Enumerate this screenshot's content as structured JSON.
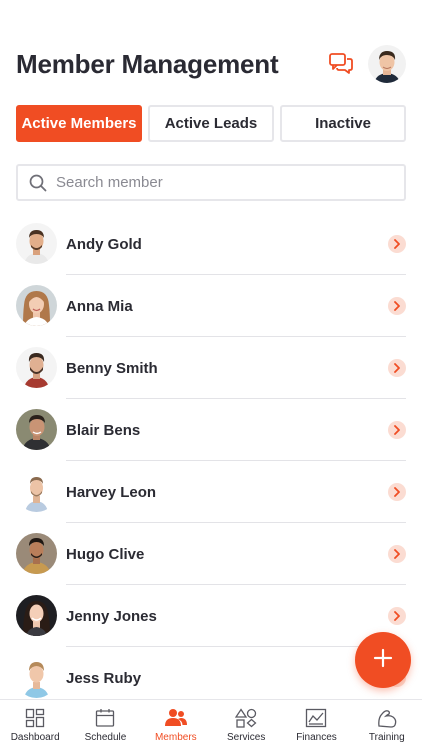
{
  "header": {
    "title": "Member Management"
  },
  "tabs": [
    {
      "label": "Active Members",
      "active": true
    },
    {
      "label": "Active Leads",
      "active": false
    },
    {
      "label": "Inactive",
      "active": false
    }
  ],
  "search": {
    "placeholder": "Search member",
    "value": ""
  },
  "members": [
    {
      "name": "Andy Gold"
    },
    {
      "name": "Anna Mia"
    },
    {
      "name": "Benny Smith"
    },
    {
      "name": "Blair Bens"
    },
    {
      "name": "Harvey Leon"
    },
    {
      "name": "Hugo Clive"
    },
    {
      "name": "Jenny Jones"
    },
    {
      "name": "Jess Ruby"
    }
  ],
  "nav": [
    {
      "label": "Dashboard",
      "icon": "dashboard-icon"
    },
    {
      "label": "Schedule",
      "icon": "calendar-icon"
    },
    {
      "label": "Members",
      "icon": "members-icon",
      "active": true
    },
    {
      "label": "Services",
      "icon": "services-icon"
    },
    {
      "label": "Finances",
      "icon": "finances-icon"
    },
    {
      "label": "Training",
      "icon": "training-icon"
    }
  ],
  "colors": {
    "accent": "#f04d23",
    "chevron_bg": "#fbdcd2",
    "border": "#e6e6ea",
    "text": "#2b2b33"
  }
}
